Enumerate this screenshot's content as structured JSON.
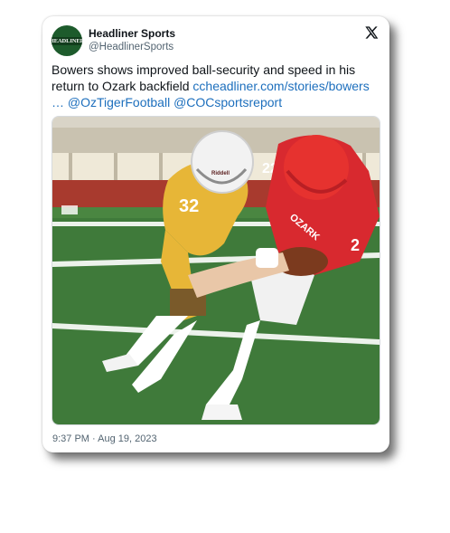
{
  "author": {
    "avatar_text": "HEADLINER",
    "name": "Headliner Sports",
    "handle": "@HeadlinerSports"
  },
  "platform_icon": "x-logo-icon",
  "tweet": {
    "text": "Bowers shows improved ball-security and speed in his return to Ozark backfield",
    "link": "ccheadliner.com/stories/bowers",
    "ellipsis": "…",
    "mention_1": "@OzTigerFootball",
    "mention_2": "@COCsportsreport"
  },
  "photo": {
    "player_left_number": "32",
    "player_left_side_number": "22",
    "player_right_number": "2",
    "player_right_jersey_text": "OZARK",
    "helmet_brand": "Riddell"
  },
  "timestamp": "9:37 PM · Aug 19, 2023",
  "colors": {
    "link": "#1d6fbd",
    "avatar_bg": "#1d5b2c",
    "red_jersey": "#d8292f",
    "gold_jersey": "#e7b637",
    "turf": "#3f7a3a"
  }
}
